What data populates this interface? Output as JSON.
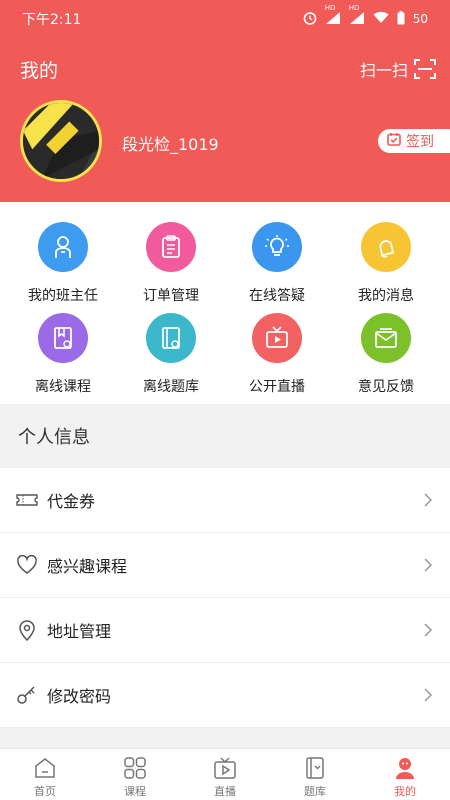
{
  "status": {
    "time": "下午2:11",
    "battery": "50",
    "hd1": "HD",
    "hd2": "HD"
  },
  "header": {
    "title": "我的",
    "scan_label": "扫一扫"
  },
  "profile": {
    "username": "段光检_1019",
    "checkin_label": "签到"
  },
  "grid": [
    {
      "label": "我的班主任",
      "color": "#3d9bf0",
      "icon": "teacher-icon"
    },
    {
      "label": "订单管理",
      "color": "#f15b9d",
      "icon": "clipboard-icon"
    },
    {
      "label": "在线答疑",
      "color": "#3b97ee",
      "icon": "bulb-icon"
    },
    {
      "label": "我的消息",
      "color": "#f7c534",
      "icon": "bell-icon"
    },
    {
      "label": "离线课程",
      "color": "#9b6ae6",
      "icon": "offline-course-icon"
    },
    {
      "label": "离线题库",
      "color": "#3cb7cc",
      "icon": "offline-bank-icon"
    },
    {
      "label": "公开直播",
      "color": "#f26262",
      "icon": "tv-icon"
    },
    {
      "label": "意见反馈",
      "color": "#7dc12a",
      "icon": "mail-icon"
    }
  ],
  "section_title": "个人信息",
  "list": [
    {
      "label": "代金券",
      "icon": "voucher-icon"
    },
    {
      "label": "感兴趣课程",
      "icon": "heart-icon"
    },
    {
      "label": "地址管理",
      "icon": "location-icon"
    },
    {
      "label": "修改密码",
      "icon": "key-icon"
    }
  ],
  "tabs": [
    {
      "label": "首页",
      "icon": "home-icon"
    },
    {
      "label": "课程",
      "icon": "grid-icon"
    },
    {
      "label": "直播",
      "icon": "live-icon"
    },
    {
      "label": "题库",
      "icon": "question-bank-icon"
    },
    {
      "label": "我的",
      "icon": "profile-icon",
      "active": true
    }
  ],
  "colors": {
    "brand": "#f05a57"
  }
}
